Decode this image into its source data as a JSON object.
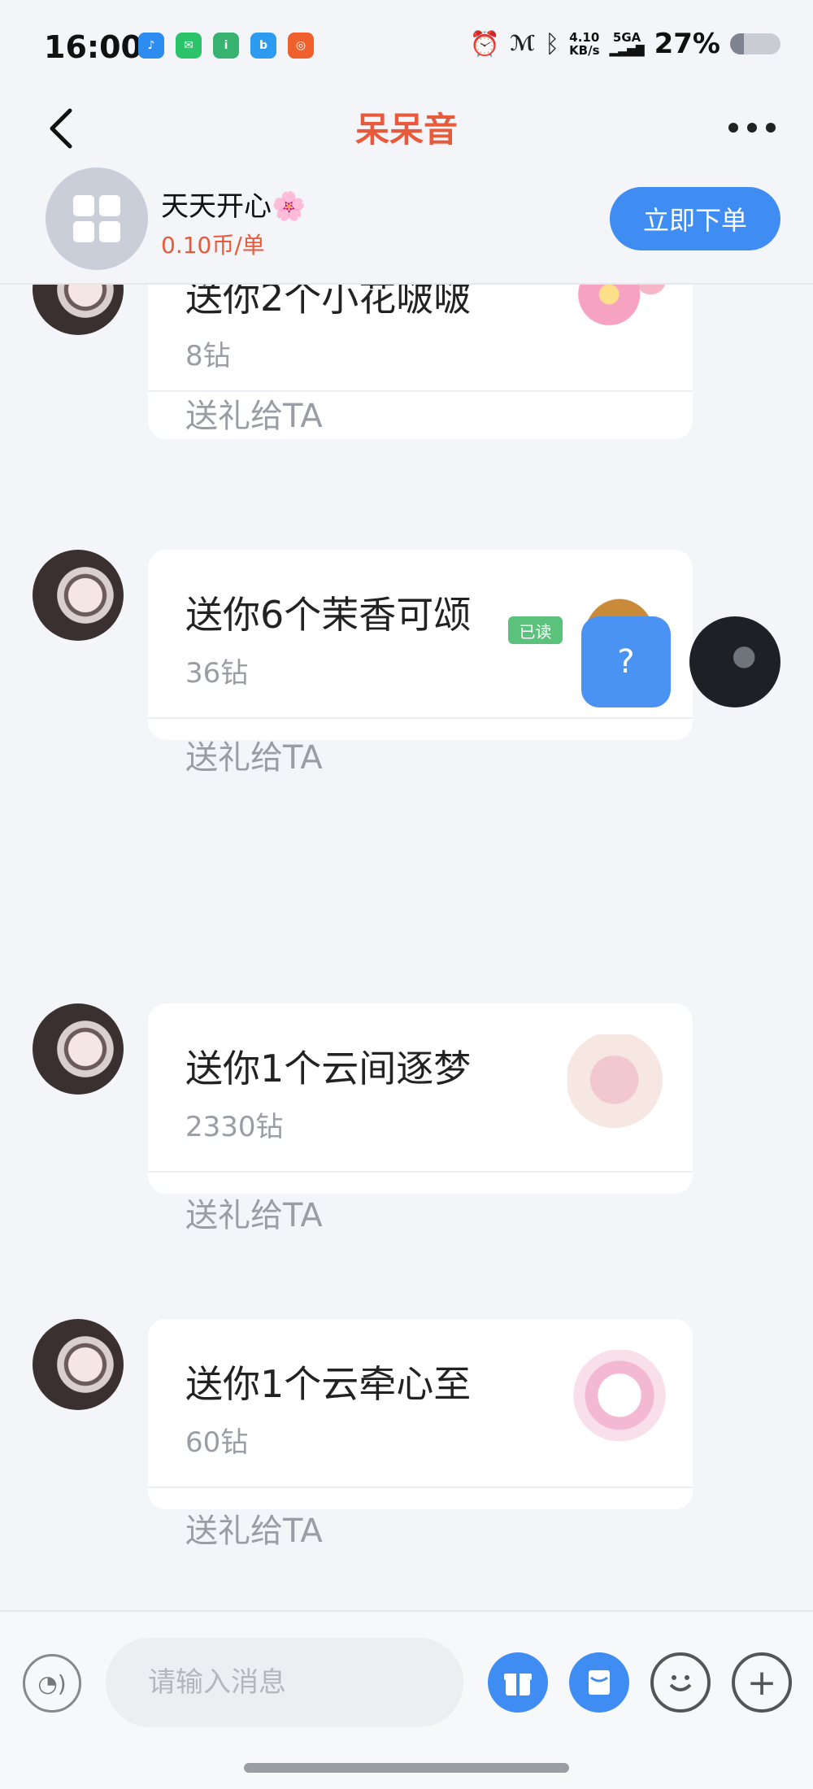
{
  "status_bar": {
    "time": "16:00",
    "net_speed_top": "4.10",
    "net_speed_bottom": "KB/s",
    "signal_label": "5GA",
    "battery_percent": "27%",
    "battery_level": 0.27
  },
  "nav": {
    "title": "呆呆音",
    "back_icon": "chevron-left-icon",
    "more_icon": "more-dots-icon"
  },
  "service": {
    "name": "天天开心🌸",
    "price": "0.10币/单",
    "order_button": "立即下单"
  },
  "messages": [
    {
      "type": "gift",
      "title": "送你2个小花啵啵",
      "price": "8钻",
      "action": "送礼给TA"
    },
    {
      "type": "gift",
      "title": "送你6个茉香可颂",
      "price": "36钻",
      "action": "送礼给TA"
    },
    {
      "type": "text",
      "sender": "me",
      "content": "?",
      "read_status": "已读"
    },
    {
      "type": "gift",
      "title": "送你1个云间逐梦",
      "price": "2330钻",
      "action": "送礼给TA"
    },
    {
      "type": "gift",
      "title": "送你1个云牵心至",
      "price": "60钻",
      "action": "送礼给TA"
    }
  ],
  "input_bar": {
    "placeholder": "请输入消息",
    "voice_icon": "voice-icon",
    "gift_icon": "gift-icon",
    "redpacket_icon": "red-packet-icon",
    "emoji_icon": "emoji-icon",
    "plus_icon": "plus-icon"
  },
  "colors": {
    "accent": "#3f8cf2",
    "title_red": "#e85a3c",
    "read_green": "#5ac27a"
  }
}
